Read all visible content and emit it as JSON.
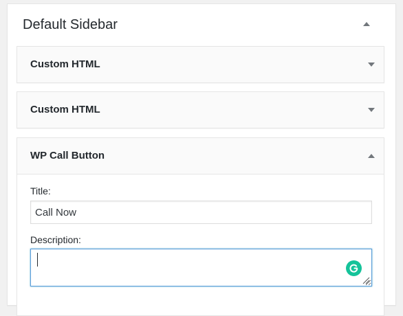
{
  "sidebar": {
    "title": "Default Sidebar",
    "toggle_icon": "arrow-up-icon"
  },
  "widgets": [
    {
      "title": "Custom HTML",
      "state": "collapsed",
      "toggle_icon": "arrow-down-icon"
    },
    {
      "title": "Custom HTML",
      "state": "collapsed",
      "toggle_icon": "arrow-down-icon"
    },
    {
      "title": "WP Call Button",
      "state": "expanded",
      "toggle_icon": "arrow-up-icon",
      "fields": {
        "title_label": "Title:",
        "title_value": "Call Now",
        "description_label": "Description:",
        "description_value": ""
      }
    }
  ],
  "colors": {
    "focus_border": "#5b9dd9",
    "grammarly": "#15c39a",
    "arrow": "#72777c"
  },
  "icons": {
    "grammarly": "grammarly-icon",
    "resize": "resize-handle-icon"
  }
}
